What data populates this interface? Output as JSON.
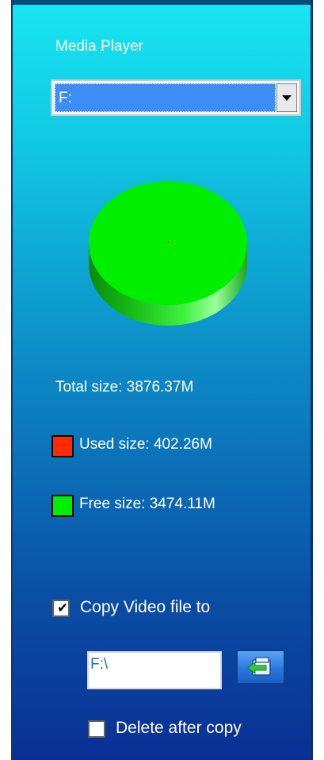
{
  "window": {
    "title": "Media Player"
  },
  "drive": {
    "selected": "F:"
  },
  "storage": {
    "total_label": "Total size: 3876.37M",
    "used_label": "Used size: 402.26M",
    "free_label": "Free size: 3474.11M",
    "used_color": "#ff2a00",
    "free_color": "#00ee00",
    "used_fraction": 0.1038
  },
  "copy_video": {
    "label": "Copy Video file to",
    "checked": true,
    "path": "F:\\"
  },
  "delete_after": {
    "label": "Delete after copy",
    "checked": false
  },
  "icons": {
    "browse": "folder-arrow-icon",
    "dropdown": "chevron-down-icon"
  }
}
